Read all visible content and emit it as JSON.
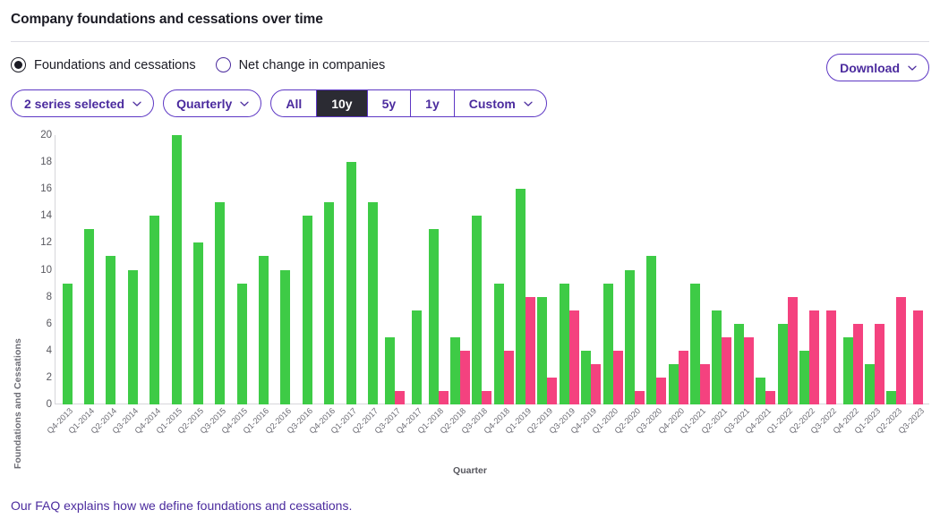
{
  "header": {
    "title": "Company foundations and cessations over time"
  },
  "view_modes": [
    {
      "label": "Foundations and cessations",
      "selected": true
    },
    {
      "label": "Net change in companies",
      "selected": false
    }
  ],
  "download": {
    "label": "Download",
    "icon": "chevron-down-icon"
  },
  "controls": {
    "series_selector": {
      "label": "2 series selected",
      "icon": "chevron-down-icon"
    },
    "frequency_selector": {
      "label": "Quarterly",
      "icon": "chevron-down-icon"
    },
    "range_segments": [
      {
        "label": "All",
        "active": false,
        "caret": false
      },
      {
        "label": "10y",
        "active": true,
        "caret": false
      },
      {
        "label": "5y",
        "active": false,
        "caret": false
      },
      {
        "label": "1y",
        "active": false,
        "caret": false
      },
      {
        "label": "Custom",
        "active": false,
        "caret": true
      }
    ]
  },
  "footer": {
    "link_text": "Our FAQ explains how we define foundations and cessations."
  },
  "colors": {
    "foundations": "#3ecb46",
    "cessations": "#f4427f",
    "accent": "#4b2b9e",
    "active_segment_bg": "#2b2b33"
  },
  "chart_data": {
    "type": "bar",
    "title": "Company foundations and cessations over time",
    "xlabel": "Quarter",
    "ylabel": "Foundations and Cessations",
    "ylim": [
      0,
      20
    ],
    "yticks": [
      0,
      2,
      4,
      6,
      8,
      10,
      12,
      14,
      16,
      18,
      20
    ],
    "grid": false,
    "legend": "none",
    "categories": [
      "Q4-2013",
      "Q1-2014",
      "Q2-2014",
      "Q3-2014",
      "Q4-2014",
      "Q1-2015",
      "Q2-2015",
      "Q3-2015",
      "Q4-2015",
      "Q1-2016",
      "Q2-2016",
      "Q3-2016",
      "Q4-2016",
      "Q1-2017",
      "Q2-2017",
      "Q3-2017",
      "Q4-2017",
      "Q1-2018",
      "Q2-2018",
      "Q3-2018",
      "Q4-2018",
      "Q1-2019",
      "Q2-2019",
      "Q3-2019",
      "Q4-2019",
      "Q1-2020",
      "Q2-2020",
      "Q3-2020",
      "Q4-2020",
      "Q1-2021",
      "Q2-2021",
      "Q3-2021",
      "Q4-2021",
      "Q1-2022",
      "Q2-2022",
      "Q3-2022",
      "Q4-2022",
      "Q1-2023",
      "Q2-2023",
      "Q3-2023"
    ],
    "series": [
      {
        "name": "Foundations",
        "color": "#3ecb46",
        "values": [
          9,
          13,
          11,
          10,
          14,
          20,
          12,
          15,
          9,
          11,
          10,
          14,
          15,
          18,
          15,
          5,
          7,
          13,
          5,
          14,
          9,
          16,
          8,
          9,
          4,
          9,
          10,
          11,
          3,
          9,
          7,
          6,
          2,
          6,
          4,
          0,
          5,
          3,
          1,
          0
        ]
      },
      {
        "name": "Cessations",
        "color": "#f4427f",
        "values": [
          0,
          0,
          0,
          0,
          0,
          0,
          0,
          0,
          0,
          0,
          0,
          0,
          0,
          0,
          0,
          1,
          0,
          1,
          4,
          1,
          4,
          8,
          2,
          7,
          3,
          4,
          1,
          2,
          4,
          3,
          5,
          5,
          1,
          8,
          7,
          7,
          6,
          6,
          8,
          7
        ]
      }
    ]
  }
}
